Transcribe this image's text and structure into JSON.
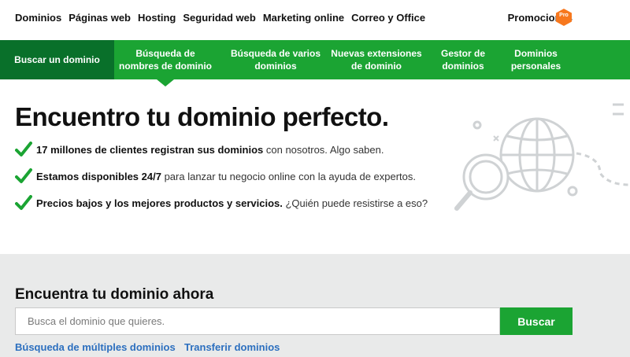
{
  "topnav": {
    "links": [
      "Dominios",
      "Páginas web",
      "Hosting",
      "Seguridad web",
      "Marketing online",
      "Correo y Office"
    ],
    "promo_label": "Promociones",
    "pro_badge": "Pro"
  },
  "subnav": {
    "items": [
      {
        "label": "Buscar un dominio"
      },
      {
        "label": "Búsqueda de nombres de dominio"
      },
      {
        "label": "Búsqueda de varios dominios"
      },
      {
        "label": "Nuevas extensiones de dominio"
      },
      {
        "label": "Gestor de dominios"
      },
      {
        "label": "Dominios personales"
      }
    ]
  },
  "hero": {
    "title": "Encuentro tu dominio perfecto.",
    "features": [
      {
        "bold": "17 millones de clientes registran sus dominios",
        "rest": " con nosotros. Algo saben."
      },
      {
        "bold": "Estamos disponibles 24/7",
        "rest": " para lanzar tu negocio online con la ayuda de expertos."
      },
      {
        "bold": "Precios bajos y los mejores productos y servicios.",
        "rest": " ¿Quién puede resistirse a eso?"
      }
    ]
  },
  "search": {
    "title": "Encuentra tu dominio ahora",
    "placeholder": "Busca el dominio que quieres.",
    "button_label": "Buscar",
    "links": [
      "Búsqueda de múltiples dominios",
      "Transferir dominios"
    ]
  },
  "colors": {
    "brand_green": "#1ba433",
    "active_green": "#09702a",
    "promo_orange": "#f7781e",
    "link_blue": "#2c6fbf"
  },
  "icons": [
    "checkmark-icon",
    "magnifier-globe-illustration",
    "pro-hexagon-icon"
  ]
}
